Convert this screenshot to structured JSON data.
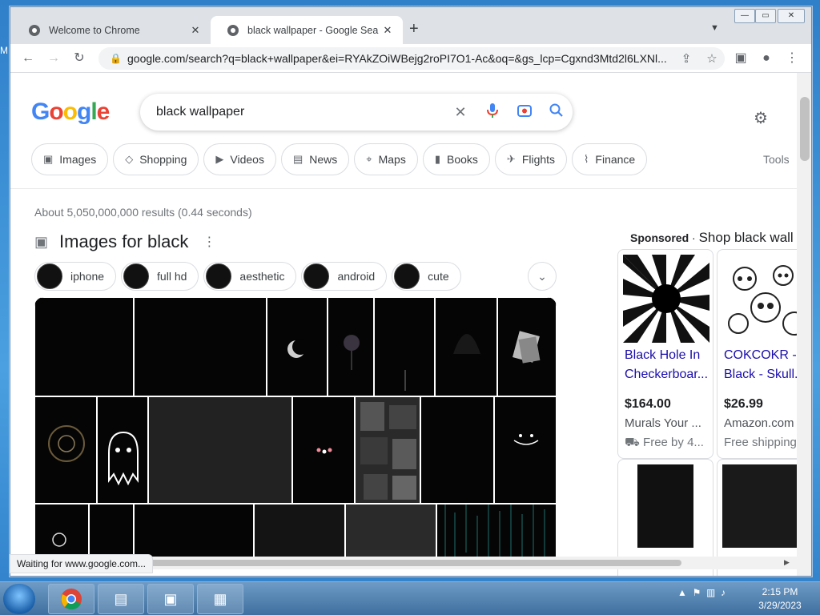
{
  "browser": {
    "tabs": [
      {
        "title": "Welcome to Chrome",
        "active": false
      },
      {
        "title": "black wallpaper - Google Search",
        "active": true
      }
    ],
    "new_tab": "+",
    "url": "google.com/search?q=black+wallpaper&ei=RYAkZOiWBejg2roPI7O1-Ac&oq=&gs_lcp=Cgxnd3Mtd2l6LXNl...",
    "status": "Waiting for www.google.com..."
  },
  "search": {
    "query": "black wallpaper",
    "tools": "Tools",
    "result_stats": "About 5,050,000,000 results (0.44 seconds)",
    "chips": [
      {
        "label": "Images",
        "icon": "image-icon"
      },
      {
        "label": "Shopping",
        "icon": "tag-icon"
      },
      {
        "label": "Videos",
        "icon": "play-icon"
      },
      {
        "label": "News",
        "icon": "news-icon"
      },
      {
        "label": "Maps",
        "icon": "pin-icon"
      },
      {
        "label": "Books",
        "icon": "book-icon"
      },
      {
        "label": "Flights",
        "icon": "plane-icon"
      },
      {
        "label": "Finance",
        "icon": "finance-icon"
      }
    ]
  },
  "images": {
    "title": "Images for black",
    "refine": [
      "iphone",
      "full hd",
      "aesthetic",
      "android",
      "cute"
    ]
  },
  "shopping": {
    "sponsored": "Sponsored",
    "shop_label": "Shop black wall",
    "products": [
      {
        "title1": "Black Hole In",
        "title2": "Checkerboar...",
        "price": "$164.00",
        "merchant": "Murals Your ...",
        "shipping": "Free by 4..."
      },
      {
        "title1": "COKCOKR -",
        "title2": "Black - Skull...",
        "price": "$26.99",
        "merchant": "Amazon.com",
        "shipping": "Free shipping"
      }
    ]
  },
  "taskbar": {
    "time": "2:15 PM",
    "date": "3/29/2023"
  },
  "colors": {
    "google_blue": "#4285f4",
    "google_red": "#ea4335",
    "google_yellow": "#fbbc05",
    "google_green": "#34a853",
    "link": "#1a0dab"
  }
}
